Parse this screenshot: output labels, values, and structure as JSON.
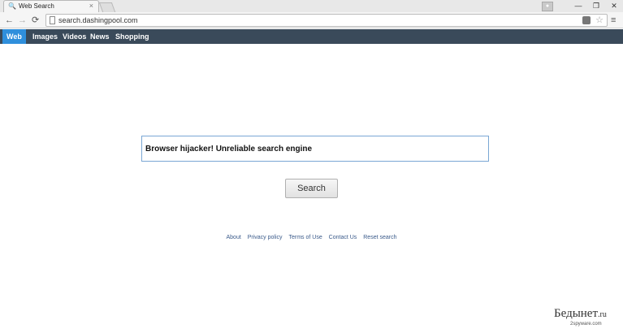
{
  "browser": {
    "tab_title": "Web Search",
    "tab_close": "×",
    "tab_icon": "🔍",
    "url": "search.dashingpool.com",
    "back_glyph": "←",
    "forward_glyph": "→",
    "reload_glyph": "⟳",
    "menu_glyph": "≡",
    "star_glyph": "☆",
    "minimize_glyph": "—",
    "restore_glyph": "❐",
    "close_glyph": "✕"
  },
  "nav": {
    "items": [
      {
        "label": "Web",
        "active": true
      },
      {
        "label": "Images",
        "active": false
      },
      {
        "label": "Videos",
        "active": false
      },
      {
        "label": "News",
        "active": false
      },
      {
        "label": "Shopping",
        "active": false
      }
    ]
  },
  "search": {
    "value": "Browser hijacker! Unreliable search engine",
    "button_label": "Search"
  },
  "footer": {
    "links": [
      "About",
      "Privacy policy",
      "Terms of Use",
      "Contact Us",
      "Reset search"
    ]
  },
  "watermark": {
    "main": "Бедынет",
    "suffix": ".ru",
    "sub": "2spyware.com"
  },
  "colors": {
    "navbar_bg": "#3a4a5a",
    "nav_active": "#2f8fdc",
    "footer_link": "#3a5a8a"
  }
}
